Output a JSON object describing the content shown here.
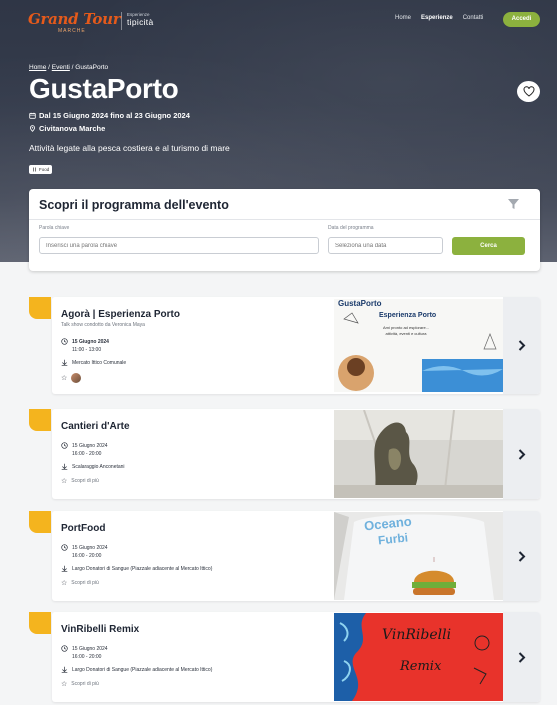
{
  "nav": {
    "logo": "Grand Tour",
    "logo_sub": "MARCHE",
    "partner_small": "Esperienze",
    "partner_big": "tipicità",
    "links": [
      "Home",
      "Esperienze",
      "Contatti"
    ],
    "login": "Accedi"
  },
  "hero": {
    "breadcrumb": {
      "home": "Home",
      "events": "Eventi",
      "current": "GustaPorto"
    },
    "title": "GustaPorto",
    "date": "Dal 15 Giugno 2024 fino al 23 Giugno 2024",
    "location": "Civitanova Marche",
    "description": "Attività legate alla pesca costiera e al turismo di mare",
    "tag": "Food"
  },
  "search": {
    "title": "Scopri il programma dell'evento",
    "keyword_label": "Parola chiave",
    "keyword_placeholder": "Inserisci una parola chiave",
    "date_label": "Data del programma",
    "date_placeholder": "Seleziona una data",
    "button": "Cerca"
  },
  "events": [
    {
      "title": "Agorà | Esperienza Porto",
      "subtitle": "Talk show condotto da Veronica Maya",
      "date": "15 Giugno 2024",
      "time": "11:00 - 13:00",
      "place": "Mercato Ittico Comunale",
      "rating_label": "",
      "image_text": [
        "GustaPorto",
        "Esperienza Porto"
      ]
    },
    {
      "title": "Cantieri d'Arte",
      "subtitle": "",
      "date": "15 Giugno 2024",
      "time": "16:00 - 20:00",
      "place": "Scalaraggio Anconetani",
      "rating_label": "Scopri di più"
    },
    {
      "title": "PortFood",
      "subtitle": "",
      "date": "15 Giugno 2024",
      "time": "16:00 - 20:00",
      "place": "Largo Donatori di Sangue (Piazzale adiacente al Mercato Ittico)",
      "rating_label": "Scopri di più",
      "image_text": [
        "Oceano",
        "Furbi"
      ]
    },
    {
      "title": "VinRibelli Remix",
      "subtitle": "",
      "date": "15 Giugno 2024",
      "time": "16:00 - 20:00",
      "place": "Largo Donatori di Sangue (Piazzale adiacente al Mercato Ittico)",
      "rating_label": "Scopri di più",
      "image_text": [
        "VinRibelli",
        "Remix"
      ]
    }
  ],
  "colors": {
    "accent_green": "#8cb13e",
    "accent_yellow": "#f4b41e",
    "brand_orange": "#e55a1b"
  }
}
